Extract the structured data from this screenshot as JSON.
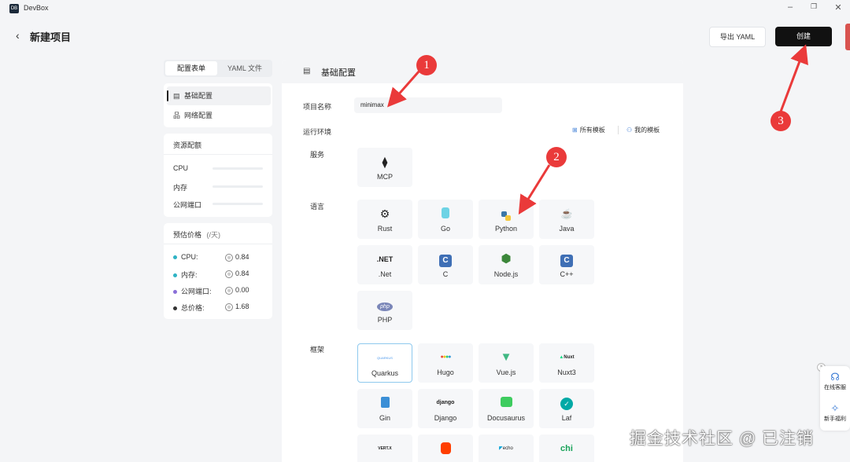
{
  "app": {
    "name": "DevBox"
  },
  "header": {
    "title": "新建项目",
    "export_label": "导出 YAML",
    "create_label": "创建"
  },
  "sidebar": {
    "tabs": [
      {
        "label": "配置表单"
      },
      {
        "label": "YAML 文件"
      }
    ],
    "nav": [
      {
        "label": "基础配置"
      },
      {
        "label": "网络配置"
      }
    ],
    "resources": {
      "title": "资源配额",
      "items": [
        {
          "label": "CPU"
        },
        {
          "label": "内存"
        },
        {
          "label": "公网端口"
        }
      ]
    },
    "pricing": {
      "title": "预估价格",
      "unit": "(/天)",
      "rows": [
        {
          "label": "CPU:",
          "value": "0.84",
          "color": "#2fb3c4"
        },
        {
          "label": "内存:",
          "value": "0.84",
          "color": "#2fb3c4"
        },
        {
          "label": "公网端口:",
          "value": "0.00",
          "color": "#8a6fd8"
        },
        {
          "label": "总价格:",
          "value": "1.68",
          "color": "#333333"
        }
      ]
    }
  },
  "main": {
    "title": "基础配置",
    "project_name_label": "项目名称",
    "project_name_value": "minimax",
    "runtime_label": "运行环境",
    "all_templates": "所有模板",
    "my_templates": "我的模板",
    "categories": {
      "service": "服务",
      "language": "语言",
      "framework": "框架"
    },
    "service_tiles": [
      {
        "label": "MCP",
        "icon": "mcp-icon"
      }
    ],
    "language_tiles": [
      {
        "label": "Rust",
        "icon": "rust-icon"
      },
      {
        "label": "Go",
        "icon": "go-icon"
      },
      {
        "label": "Python",
        "icon": "python-icon"
      },
      {
        "label": "Java",
        "icon": "java-icon"
      },
      {
        "label": ".Net",
        "icon": "dotnet-icon",
        "icon_text": ".NET"
      },
      {
        "label": "C",
        "icon": "c-icon",
        "icon_text": "C"
      },
      {
        "label": "Node.js",
        "icon": "nodejs-icon"
      },
      {
        "label": "C++",
        "icon": "cpp-icon",
        "icon_text": "C"
      },
      {
        "label": "PHP",
        "icon": "php-icon",
        "icon_text": "php"
      }
    ],
    "framework_tiles": [
      {
        "label": "Quarkus",
        "icon": "quarkus-icon",
        "icon_text": "QUARKUS"
      },
      {
        "label": "Hugo",
        "icon": "hugo-icon"
      },
      {
        "label": "Vue.js",
        "icon": "vue-icon"
      },
      {
        "label": "Nuxt3",
        "icon": "nuxt-icon",
        "icon_text": "Nuxt"
      },
      {
        "label": "Gin",
        "icon": "gin-icon"
      },
      {
        "label": "Django",
        "icon": "django-icon",
        "icon_text": "django"
      },
      {
        "label": "Docusaurus",
        "icon": "docusaurus-icon"
      },
      {
        "label": "Laf",
        "icon": "laf-icon"
      },
      {
        "label": "",
        "icon": "vertx-icon",
        "icon_text": "VERT.X"
      },
      {
        "label": "",
        "icon": "svelte-icon"
      },
      {
        "label": "",
        "icon": "echo-icon",
        "icon_text": "echo"
      },
      {
        "label": "",
        "icon": "chi-icon",
        "icon_text": "chi"
      }
    ]
  },
  "annotations": [
    {
      "label": "1"
    },
    {
      "label": "2"
    },
    {
      "label": "3"
    }
  ],
  "float_panel": {
    "service": "在线客服",
    "benefits": "新手福利"
  },
  "watermark": "掘金技术社区 @ 已注销"
}
